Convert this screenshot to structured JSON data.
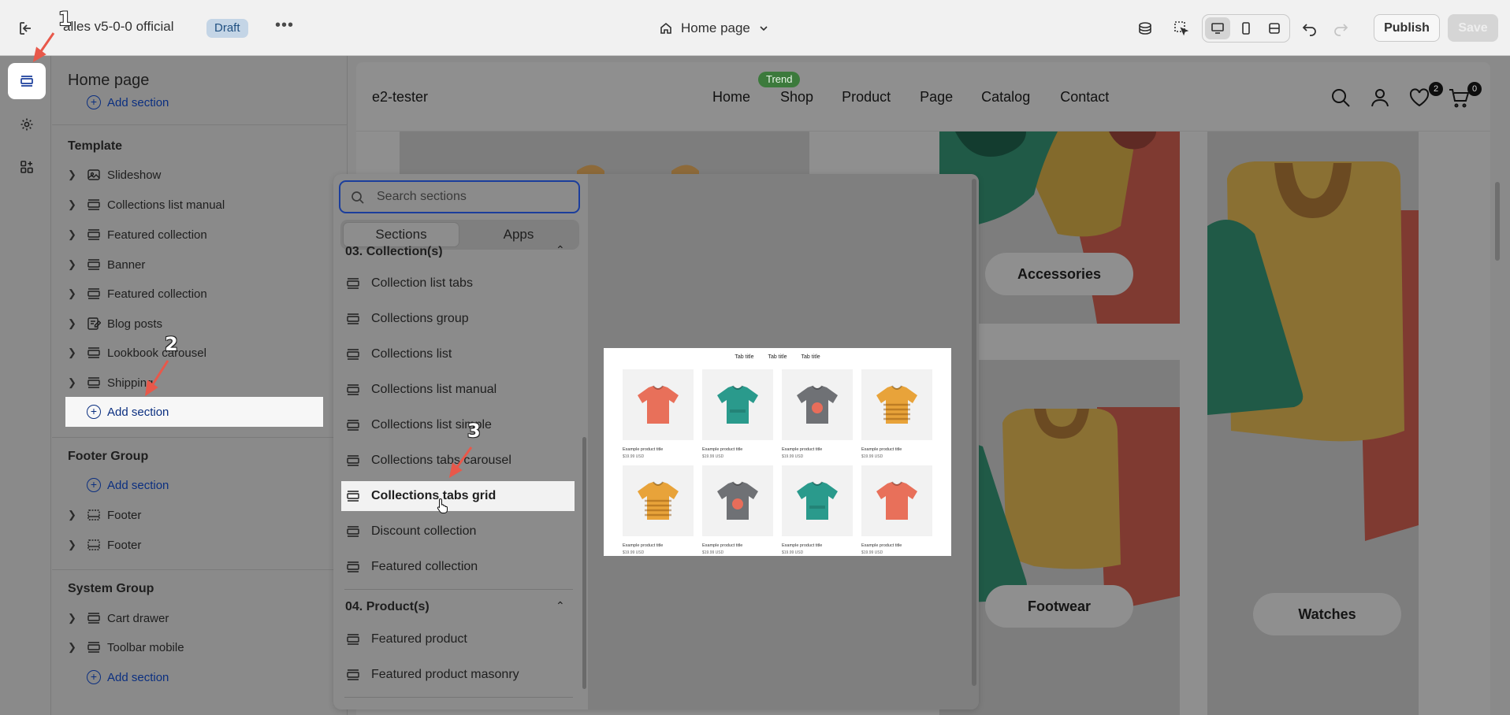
{
  "topbar": {
    "theme_name": "alles v5-0-0 official",
    "status_badge": "Draft",
    "more_label": "•••",
    "page_selector": "Home page",
    "publish_label": "Publish",
    "save_label": "Save"
  },
  "sidebar": {
    "title": "Home page",
    "cut_add_label": "Add section",
    "template_title": "Template",
    "template_items": [
      {
        "label": "Slideshow",
        "icon": "slideshow-icon"
      },
      {
        "label": "Collections list manual",
        "icon": "section-icon"
      },
      {
        "label": "Featured collection",
        "icon": "section-icon"
      },
      {
        "label": "Banner",
        "icon": "section-icon"
      },
      {
        "label": "Featured collection",
        "icon": "section-icon"
      },
      {
        "label": "Blog posts",
        "icon": "blog-icon"
      },
      {
        "label": "Lookbook carousel",
        "icon": "section-icon"
      },
      {
        "label": "Shipping",
        "icon": "section-icon"
      }
    ],
    "template_add_label": "Add section",
    "footer_title": "Footer Group",
    "footer_add_label": "Add section",
    "footer_items": [
      {
        "label": "Footer",
        "icon": "footer-icon"
      },
      {
        "label": "Footer",
        "icon": "footer-icon"
      }
    ],
    "system_title": "System Group",
    "system_items": [
      {
        "label": "Cart drawer",
        "icon": "section-icon"
      },
      {
        "label": "Toolbar mobile",
        "icon": "section-icon"
      }
    ],
    "system_add_label": "Add section"
  },
  "picker": {
    "search_placeholder": "Search sections",
    "tabs": [
      "Sections",
      "Apps"
    ],
    "category_collections": "03. Collection(s)",
    "collection_items": [
      "Collection list tabs",
      "Collections group",
      "Collections list",
      "Collections list manual",
      "Collections list simple",
      "Collections tabs carousel",
      "Collections tabs grid",
      "Discount collection",
      "Featured collection"
    ],
    "category_products": "04. Product(s)",
    "product_items": [
      "Featured product",
      "Featured product masonry"
    ],
    "preview": {
      "tabs": [
        "Tab title",
        "Tab title",
        "Tab title"
      ],
      "product_title": "Example product title",
      "product_price": "$19.99 USD",
      "shirt_colors": [
        "#e8705a",
        "#2a9a8c",
        "#6f7175",
        "#e8a33a",
        "#e8a33a",
        "#6f7175",
        "#2a9a8c",
        "#e8705a"
      ]
    }
  },
  "store": {
    "logo": "e2-tester",
    "nav": [
      "Home",
      "Shop",
      "Product",
      "Page",
      "Catalog",
      "Contact"
    ],
    "trend_badge": "Trend",
    "wishlist_count": "2",
    "cart_count": "0",
    "collections": [
      "Accessories",
      "Footwear",
      "Watches"
    ]
  },
  "annotations": [
    "1",
    "2",
    "3"
  ]
}
